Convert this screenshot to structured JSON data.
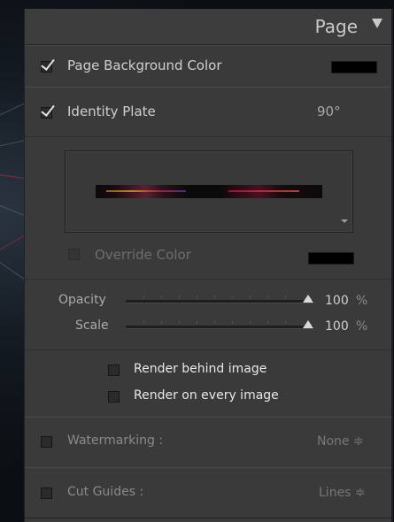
{
  "panel": {
    "title": "Page"
  },
  "page_background": {
    "label": "Page Background Color",
    "checked": true,
    "color": "#000000"
  },
  "identity_plate": {
    "label": "Identity Plate",
    "checked": true,
    "rotation": "90°",
    "override_color": {
      "label": "Override Color",
      "checked": false,
      "color": "#000000"
    },
    "opacity": {
      "label": "Opacity",
      "value": "100",
      "unit": "%",
      "fraction": 1.0
    },
    "scale": {
      "label": "Scale",
      "value": "100",
      "unit": "%",
      "fraction": 1.0
    },
    "render_behind_image": {
      "label": "Render behind image",
      "checked": false
    },
    "render_on_every_image": {
      "label": "Render on every image",
      "checked": false
    }
  },
  "watermarking": {
    "label": "Watermarking :",
    "checked": false,
    "value": "None ≑"
  },
  "cut_guides": {
    "label": "Cut Guides :",
    "checked": false,
    "value": "Lines ≑"
  }
}
